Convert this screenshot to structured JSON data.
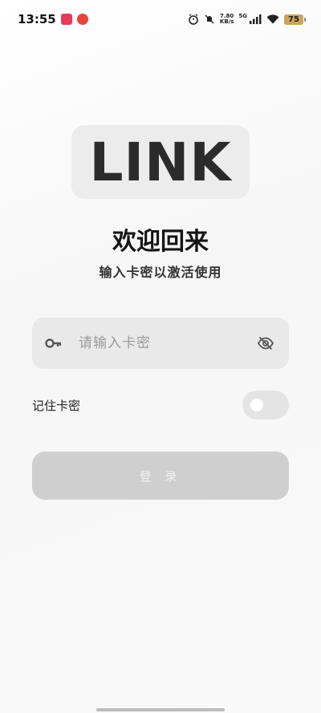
{
  "status_bar": {
    "time": "13:55",
    "net_speed_value": "7.80",
    "net_speed_unit": "KB/s",
    "network_type": "5G",
    "battery": "75",
    "icons": [
      "app-red-icon",
      "netease-music-icon",
      "alarm-icon",
      "mute-icon",
      "signal-icon",
      "wifi-icon",
      "battery-icon"
    ]
  },
  "logo": {
    "text": "LINK"
  },
  "header": {
    "title": "欢迎回来",
    "subtitle": "输入卡密以激活使用"
  },
  "code_input": {
    "placeholder": "请输入卡密",
    "value": ""
  },
  "remember": {
    "label": "记住卡密",
    "enabled": false
  },
  "login": {
    "label": "登 录"
  },
  "colors": {
    "input_bg": "#e9e9e9",
    "button_disabled": "#cfcfcf",
    "logo_bg": "#ececec"
  }
}
